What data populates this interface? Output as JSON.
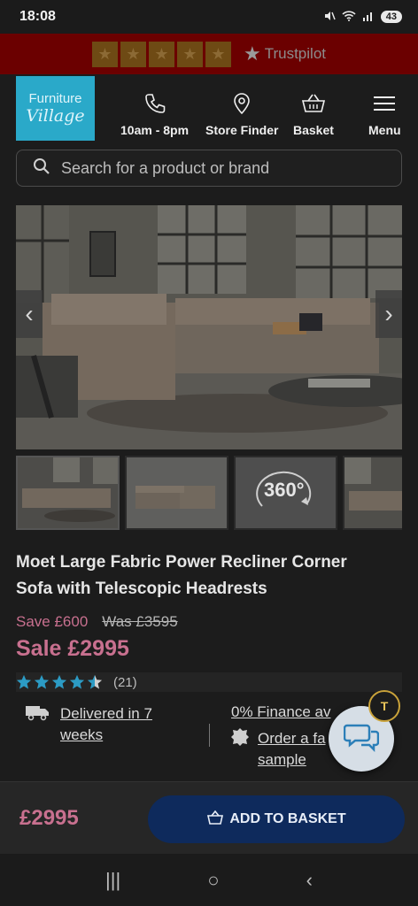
{
  "status": {
    "time": "18:08",
    "battery": "43"
  },
  "trustbar": {
    "brand": "Trustpilot",
    "star_glyph": "★"
  },
  "header": {
    "logo_line1": "Furniture",
    "logo_line2": "Village",
    "nav": [
      {
        "label": "10am - 8pm",
        "icon": "phone-icon"
      },
      {
        "label": "Store Finder",
        "icon": "location-pin-icon"
      },
      {
        "label": "Basket",
        "icon": "basket-icon"
      },
      {
        "label": "Menu",
        "icon": "hamburger-icon"
      }
    ]
  },
  "search": {
    "placeholder": "Search for a product or brand"
  },
  "gallery": {
    "prev_glyph": "‹",
    "next_glyph": "›",
    "view360_label": "360°"
  },
  "product": {
    "title": "Moet Large Fabric Power Recliner Corner Sofa with Telescopic Headrests",
    "save": "Save £600",
    "was": "Was £3595",
    "sale": "Sale £2995",
    "rating_value": 4.5,
    "rating_count": "(21)"
  },
  "info": {
    "delivery": "Delivered in 7 weeks",
    "finance": "0% Finance av",
    "sample": "Order a fa sample"
  },
  "text_scan": {
    "label": "T"
  },
  "bottom": {
    "price": "£2995",
    "add_label": "ADD TO BASKET"
  },
  "android_nav": {
    "recent": "|||",
    "home": "○",
    "back": "‹"
  },
  "colors": {
    "accent_pink": "#c8708f",
    "star_teal": "#2c9bc4",
    "button_navy": "#0e2a5c",
    "trust_red": "#6b0000"
  }
}
